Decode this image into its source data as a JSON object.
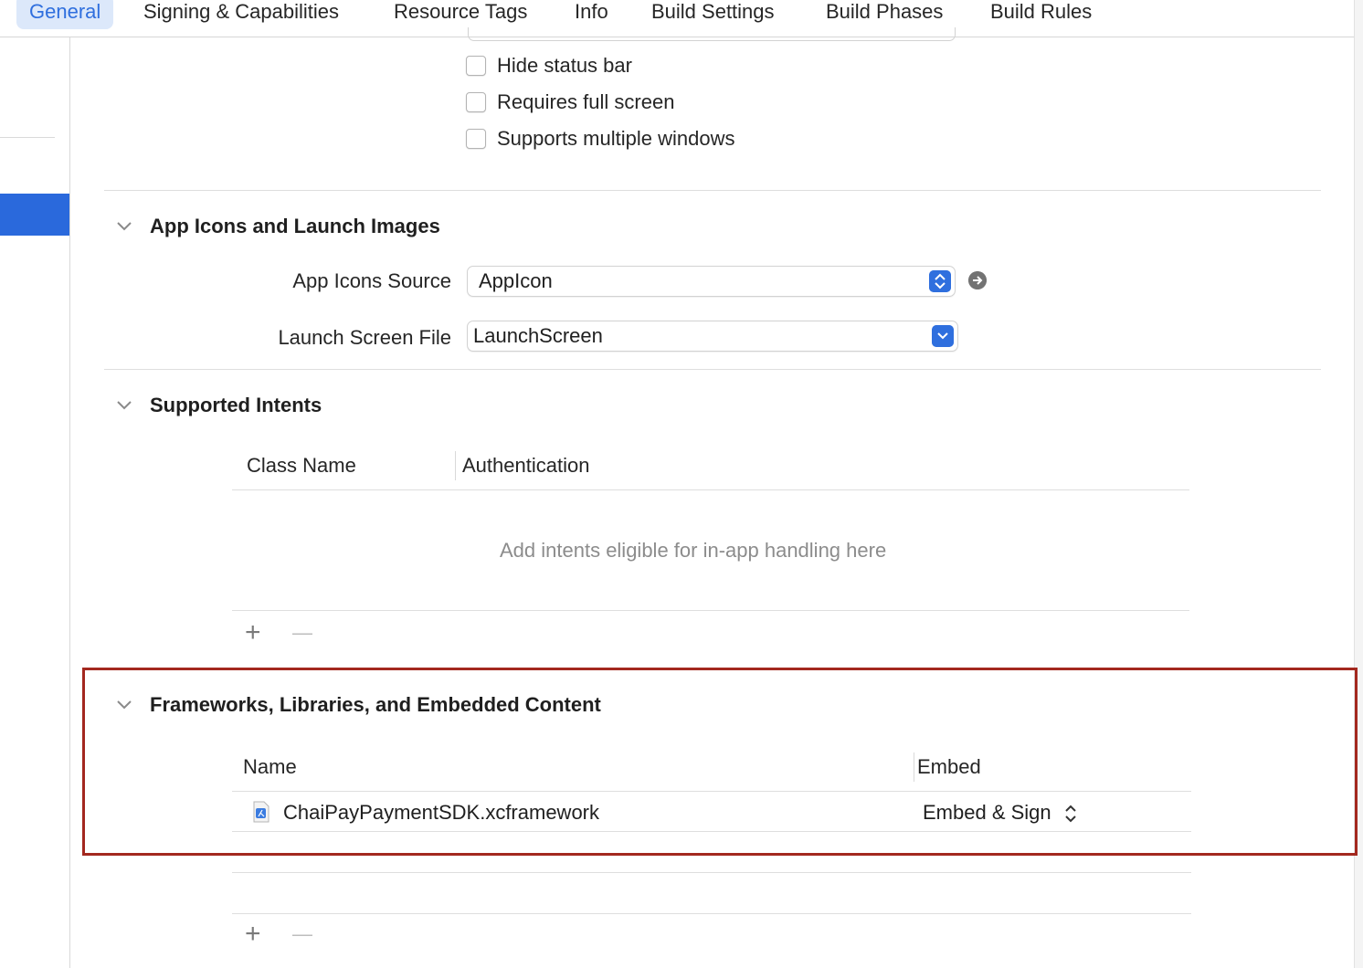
{
  "tabs": [
    {
      "label": "General",
      "active": true
    },
    {
      "label": "Signing & Capabilities"
    },
    {
      "label": "Resource Tags"
    },
    {
      "label": "Info"
    },
    {
      "label": "Build Settings"
    },
    {
      "label": "Build Phases"
    },
    {
      "label": "Build Rules"
    }
  ],
  "deployment": {
    "checkboxes": [
      {
        "label": "Hide status bar",
        "checked": false
      },
      {
        "label": "Requires full screen",
        "checked": false
      },
      {
        "label": "Supports multiple windows",
        "checked": false
      }
    ]
  },
  "app_icons": {
    "title": "App Icons and Launch Images",
    "icons_source_label": "App Icons Source",
    "icons_source_value": "AppIcon",
    "launch_screen_label": "Launch Screen File",
    "launch_screen_value": "LaunchScreen"
  },
  "intents": {
    "title": "Supported Intents",
    "columns": [
      "Class Name",
      "Authentication"
    ],
    "empty_message": "Add intents eligible for in-app handling here",
    "add_label": "+",
    "remove_label": "—"
  },
  "frameworks": {
    "title": "Frameworks, Libraries, and Embedded Content",
    "columns": [
      "Name",
      "Embed"
    ],
    "rows": [
      {
        "name": "ChaiPayPaymentSDK.xcframework",
        "embed": "Embed & Sign"
      }
    ],
    "add_label": "+",
    "remove_label": "—"
  },
  "colors": {
    "accent": "#2f6fde",
    "highlight_border": "#a3281f",
    "sidebar_selection": "#2a69dc"
  }
}
